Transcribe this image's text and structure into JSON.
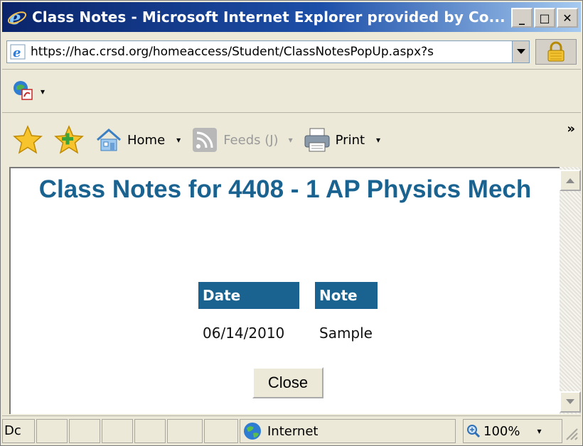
{
  "window": {
    "title": "Class Notes - Microsoft Internet Explorer provided by Co...",
    "min_symbol": "_",
    "max_symbol": "□",
    "close_symbol": "✕"
  },
  "address": {
    "url": "https://hac.crsd.org/homeaccess/Student/ClassNotesPopUp.aspx?s"
  },
  "command_bar": {
    "home_label": "Home",
    "feeds_label": "Feeds (J)",
    "print_label": "Print",
    "overflow": "»"
  },
  "page": {
    "title": "Class Notes for 4408 - 1 AP Physics Mech",
    "table": {
      "headers": [
        "Date",
        "Note"
      ],
      "rows": [
        {
          "date": "06/14/2010",
          "note": "Sample"
        }
      ]
    },
    "close_label": "Close"
  },
  "status": {
    "text": "Dc",
    "zone": "Internet",
    "zoom": "100%"
  },
  "colors": {
    "header_blue": "#1a6391",
    "title_blue": "#1a6391"
  }
}
